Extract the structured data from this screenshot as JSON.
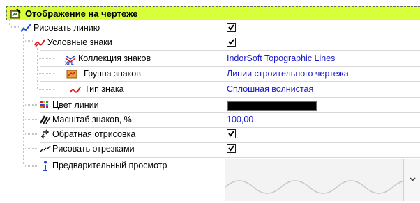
{
  "section": {
    "title": "Отображение на чертеже",
    "icon": "drawing-settings-icon"
  },
  "rows": [
    {
      "label": "Рисовать линию",
      "icon": "line-icon",
      "checked": true
    },
    {
      "label": "Условные знаки",
      "icon": "symbols-icon",
      "checked": true
    },
    {
      "label": "Коллекция знаков",
      "icon": "collection-icon",
      "value": "IndorSoft Topographic Lines"
    },
    {
      "label": "Группа знаков",
      "icon": "group-icon",
      "value": "Линии строительного чертежа"
    },
    {
      "label": "Тип знака",
      "icon": "symbol-type-icon",
      "value": "Сплошная волнистая"
    },
    {
      "label": "Цвет линии",
      "icon": "palette-icon",
      "color": "#000000"
    },
    {
      "label": "Масштаб знаков, %",
      "icon": "scale-icon",
      "value": "100,00"
    },
    {
      "label": "Обратная отрисовка",
      "icon": "reverse-icon",
      "checked": true
    },
    {
      "label": "Рисовать отрезками",
      "icon": "segments-icon",
      "checked": true
    },
    {
      "label": "Предварительный просмотр",
      "icon": "info-icon"
    }
  ],
  "colors": {
    "header_bg": "#d7ff3a",
    "value_text": "#1919c8"
  }
}
